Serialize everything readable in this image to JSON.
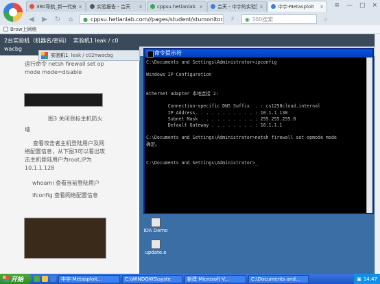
{
  "browser": {
    "tabs": [
      {
        "label": "360导航_新一代安",
        "color": "#e94b3c",
        "active": false
      },
      {
        "label": "实验报告 - 合天",
        "color": "#555555",
        "active": false
      },
      {
        "label": "cppsu.hetianlab",
        "color": "#3aa757",
        "active": false
      },
      {
        "label": "合天 - 中宇的实验室",
        "color": "#3b7ee0",
        "active": false
      },
      {
        "label": "中宇-Metasploit",
        "color": "#3b7ee0",
        "active": true
      }
    ],
    "address": "cppsu.hetianlab.com//pages/student/stumonitor.js",
    "search_placeholder": "360搜索",
    "bookmark": "Brow上网络"
  },
  "lab": {
    "title_line1": "2台实验机（机器名/密码）",
    "title_line2": "实验机1    leak / c0",
    "title_line3": "wacbg",
    "tool_label": "实验机1",
    "tool_info": "leak / c02hwacbg"
  },
  "left": {
    "p1": "运行命令 netsh firewall set op",
    "p1b": "mode mode=disable",
    "caption": "图3 关闭目标主机防火",
    "caption2": "墙",
    "p2": "查看攻击者主机登陆用户及网络配置信息，从下图3可以看出攻击主机登陆用户为root,IP为10.1.1.128",
    "p3": "whoami 查看当前登陆用户",
    "p4": "ifconfig 查看网络配置信息"
  },
  "cmd": {
    "title": "命令提示符",
    "lines": [
      "C:\\Documents and Settings\\Administrator>ipconfig",
      "",
      "Windows IP Configuration",
      "",
      "",
      "Ethernet adapter 本地连接 2:",
      "",
      "        Connection-specific DNS Suffix  . : cs1258cloud.internal",
      "        IP Address. . . . . . . . . . . : 10.1.1.130",
      "        Subnet Mask . . . . . . . . . . : 255.255.255.0",
      "        Default Gateway . . . . . . . . : 10.1.1.1",
      "",
      "C:\\Documents and Settings\\Administrator>netsh firewall set opmode mode",
      "确定。",
      "",
      "",
      "C:\\Documents and Settings\\Administrator>_"
    ]
  },
  "desktop": {
    "icon1": "IDA Demo",
    "icon2": "update.e"
  },
  "taskbar": {
    "start": "开始",
    "tasks": [
      "中宇-Metasploit...",
      "C:\\WINDOWS\\syste",
      "新建 Microsoft V...",
      "C:\\Documents and..."
    ],
    "time": "14:47"
  }
}
